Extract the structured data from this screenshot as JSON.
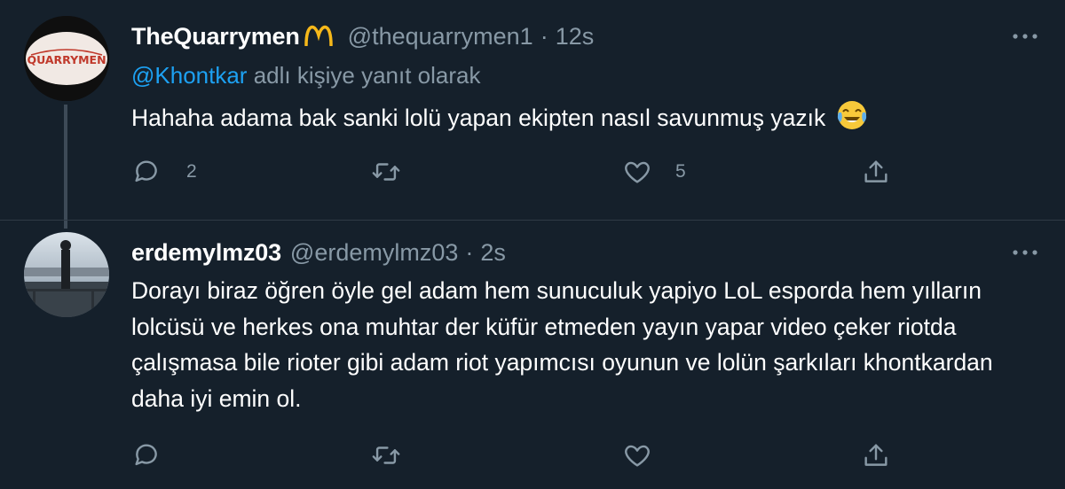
{
  "tweets": [
    {
      "display_name": "TheQuarrymen",
      "handle": "@thequarrymen1",
      "separator": "·",
      "time": "12s",
      "avatar_text": "QUARRYMEN",
      "reply_to": {
        "mention": "@Khontkar",
        "suffix": " adlı kişiye yanıt olarak"
      },
      "text": "Hahaha adama bak sanki lolü yapan ekipten nasıl savunmuş yazık",
      "actions": {
        "replies": "2",
        "retweets": "",
        "likes": "5"
      }
    },
    {
      "display_name": "erdemylmz03",
      "handle": "@erdemylmz03",
      "separator": "·",
      "time": "2s",
      "text": "Dorayı biraz öğren öyle gel adam hem sunuculuk yapiyo LoL esporda hem yılların lolcüsü ve herkes ona muhtar der küfür etmeden yayın yapar video çeker riotda çalışmasa bile rioter gibi adam riot yapımcısı oyunun ve lolün şarkıları khontkardan daha iyi emin ol.",
      "actions": {
        "replies": "",
        "retweets": "",
        "likes": ""
      }
    }
  ],
  "icons": {
    "reply": "speech-bubble",
    "retweet": "retweet-arrows",
    "like": "heart",
    "share": "share-upload",
    "more": "three-dots",
    "emoji": "face-with-tears-of-joy",
    "badge": "golden-m-arches"
  },
  "colors": {
    "background": "#15202b",
    "text": "#ffffff",
    "muted": "#8899a6",
    "accent": "#1da1f2",
    "badge": "#f6b81a"
  }
}
